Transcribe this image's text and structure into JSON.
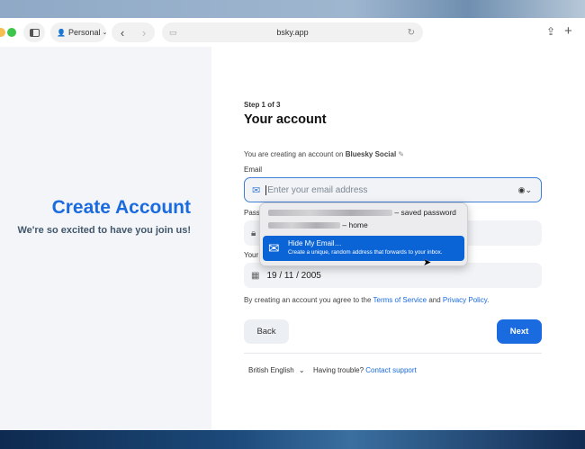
{
  "browser": {
    "profile": "Personal",
    "url": "bsky.app"
  },
  "left": {
    "title": "Create Account",
    "subtitle": "We're so excited to have you join us!"
  },
  "form": {
    "step": "Step 1 of 3",
    "heading": "Your account",
    "provider_prefix": "You are creating an account on",
    "provider": "Bluesky Social",
    "email_label": "Email",
    "email_placeholder": "Enter your email address",
    "password_label_visible": "Pass",
    "birth_label_visible": "Your",
    "birth_date": "19 / 11 / 2005",
    "terms_prefix": "By creating an account you agree to the",
    "terms": "Terms of Service",
    "and": "and",
    "privacy": "Privacy Policy",
    "period": ".",
    "back": "Back",
    "next": "Next",
    "language": "British English",
    "trouble": "Having trouble?",
    "support": "Contact support"
  },
  "autofill": {
    "item1_suffix": "– saved password",
    "item2_suffix": "– home",
    "hide_title": "Hide My Email…",
    "hide_desc": "Create a unique, random address that forwards to your inbox."
  },
  "colors": {
    "accent": "#1a6be0",
    "selection": "#0a64d6"
  }
}
